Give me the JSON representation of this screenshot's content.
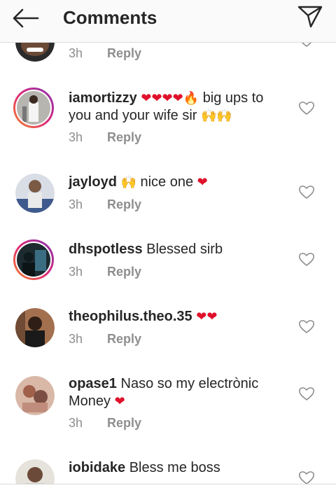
{
  "header": {
    "title": "Comments",
    "back_icon": "arrow-left-icon",
    "send_icon": "paper-plane-icon"
  },
  "comments": [
    {
      "time": "3h",
      "reply_label": "Reply"
    },
    {
      "username": "iamortizzy",
      "text_a": "❤❤❤❤🔥",
      "text_b": " big ups to you and your wife sir ",
      "text_c": "🙌🙌",
      "time": "3h",
      "reply_label": "Reply"
    },
    {
      "username": "jayloyd",
      "text_a": "🙌",
      "text_b": " nice one ",
      "text_c": "❤",
      "time": "3h",
      "reply_label": "Reply"
    },
    {
      "username": "dhspotless",
      "text_b": " Blessed sirb",
      "time": "3h",
      "reply_label": "Reply"
    },
    {
      "username": "theophilus.theo.35",
      "text_a": " ❤❤",
      "time": "3h",
      "reply_label": "Reply"
    },
    {
      "username": "opase1",
      "text_b": " Naso so my electrònic Money ",
      "text_c": "❤",
      "time": "3h",
      "reply_label": "Reply"
    },
    {
      "username": "iobidake",
      "text_b": " Bless me boss"
    }
  ],
  "colors": {
    "username": "#262626",
    "meta": "#8e8e8e",
    "heart_emoji": "#e0102a",
    "story_ring": "#dd2a7b"
  }
}
